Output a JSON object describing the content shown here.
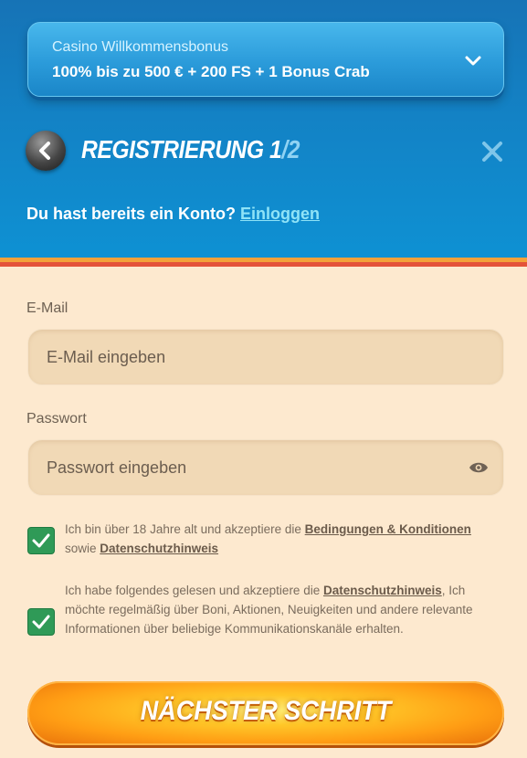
{
  "bonus": {
    "title": "Casino Willkommensbonus",
    "subtitle": "100% bis zu 500 € + 200 FS + 1 Bonus Crab"
  },
  "header": {
    "title_main": "REGISTRIERUNG 1",
    "title_frac": "/2"
  },
  "login": {
    "prompt": "Du hast bereits ein Konto? ",
    "link": "Einloggen"
  },
  "form": {
    "email_label": "E-Mail",
    "email_placeholder": "E-Mail eingeben",
    "password_label": "Passwort",
    "password_placeholder": "Passwort eingeben"
  },
  "consent1": {
    "text_a": "Ich bin über 18 Jahre alt und akzeptiere die ",
    "link_a": "Bedingungen & Konditionen",
    "text_b": " sowie ",
    "link_b": "Datenschutzhinweis"
  },
  "consent2": {
    "text_a": "Ich habe folgendes gelesen und akzeptiere die ",
    "link_a": "Datenschutzhinweis",
    "text_b": ", Ich möchte regelmäßig über Boni, Aktionen, Neuigkeiten und andere relevante Informationen über beliebige Kommunikationskanäle erhalten."
  },
  "submit_label": "NÄCHSTER SCHRITT",
  "colors": {
    "header_blue": "#1382c5",
    "form_bg": "#fde9cf",
    "checkbox_green": "#2f9a57",
    "button_orange": "#ff9d14"
  }
}
